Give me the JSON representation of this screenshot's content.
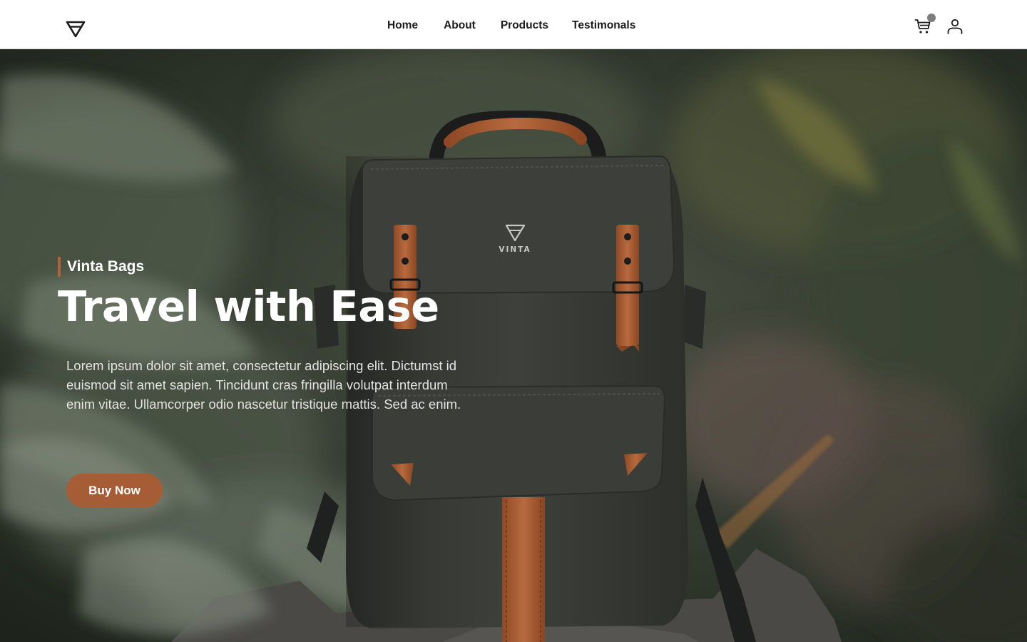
{
  "nav": {
    "links": [
      "Home",
      "About",
      "Products",
      "Testimonals"
    ]
  },
  "hero": {
    "eyebrow": "Vinta Bags",
    "headline": "Travel with Ease",
    "body": "Lorem ipsum dolor sit amet, consectetur adipiscing elit. Dictumst id euismod sit amet sapien. Tincidunt cras fringilla volutpat interdum enim vitae. Ullamcorper odio nascetur tristique mattis. Sed ac enim.",
    "cta_label": "Buy Now",
    "bag_brand": "VINTA"
  },
  "icons": {
    "logo": "triangle-logo-icon",
    "cart": "cart-icon",
    "user": "user-icon"
  },
  "colors": {
    "accent": "#a65d36",
    "leather": "#b0643b",
    "bag": "#3a3d37",
    "foliage": "#2b3329"
  }
}
